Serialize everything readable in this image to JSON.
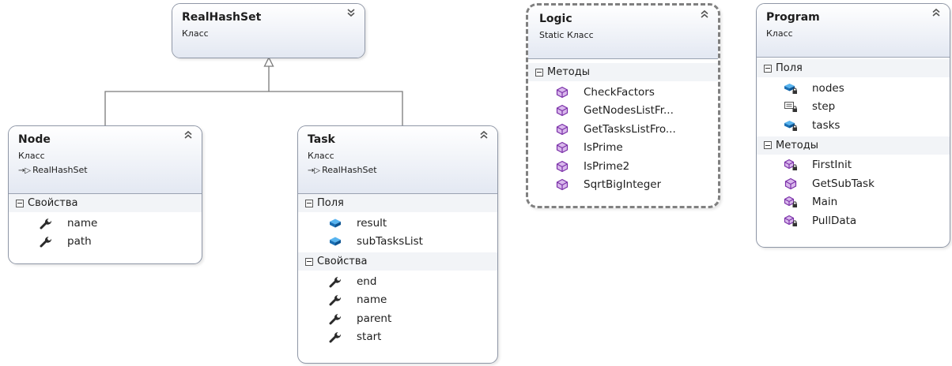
{
  "classes": {
    "realhashset": {
      "name": "RealHashSet",
      "kind": "Класс"
    },
    "node": {
      "name": "Node",
      "kind": "Класс",
      "inherits": "RealHashSet",
      "sections": [
        {
          "title": "Свойства",
          "members": [
            {
              "name": "name"
            },
            {
              "name": "path"
            }
          ]
        }
      ]
    },
    "task": {
      "name": "Task",
      "kind": "Класс",
      "inherits": "RealHashSet",
      "sections": [
        {
          "title": "Поля",
          "members": [
            {
              "name": "result"
            },
            {
              "name": "subTasksList"
            }
          ]
        },
        {
          "title": "Свойства",
          "members": [
            {
              "name": "end"
            },
            {
              "name": "name"
            },
            {
              "name": "parent"
            },
            {
              "name": "start"
            }
          ]
        }
      ]
    },
    "logic": {
      "name": "Logic",
      "kind": "Static Класс",
      "sections": [
        {
          "title": "Методы",
          "members": [
            {
              "name": "CheckFactors"
            },
            {
              "name": "GetNodesListFr..."
            },
            {
              "name": "GetTasksListFro..."
            },
            {
              "name": "IsPrime"
            },
            {
              "name": "IsPrime2"
            },
            {
              "name": "SqrtBigInteger"
            }
          ]
        }
      ]
    },
    "program": {
      "name": "Program",
      "kind": "Класс",
      "sections": [
        {
          "title": "Поля",
          "members": [
            {
              "name": "nodes"
            },
            {
              "name": "step"
            },
            {
              "name": "tasks"
            }
          ]
        },
        {
          "title": "Методы",
          "members": [
            {
              "name": "FirstInit"
            },
            {
              "name": "GetSubTask"
            },
            {
              "name": "Main"
            },
            {
              "name": "PullData"
            }
          ]
        }
      ]
    }
  },
  "icons": {
    "toggle_expand": "chevron-double-down-icon",
    "toggle_collapse": "chevron-double-up-icon",
    "section_collapse": "collapse-minus-icon",
    "inherit": "inherit-arrow-icon",
    "property": "wrench-property-icon",
    "field": "field-icon",
    "private_field": "private-field-icon",
    "private_constant": "private-constant-field-icon",
    "method": "method-icon",
    "private_method": "private-method-icon"
  },
  "colors": {
    "header_gradient_bottom": "#e3e8f2",
    "border": "#8e96a6",
    "field_blue": "#1a7fc4",
    "method_purple": "#8a3fb0",
    "connector": "#7a7a7a"
  }
}
